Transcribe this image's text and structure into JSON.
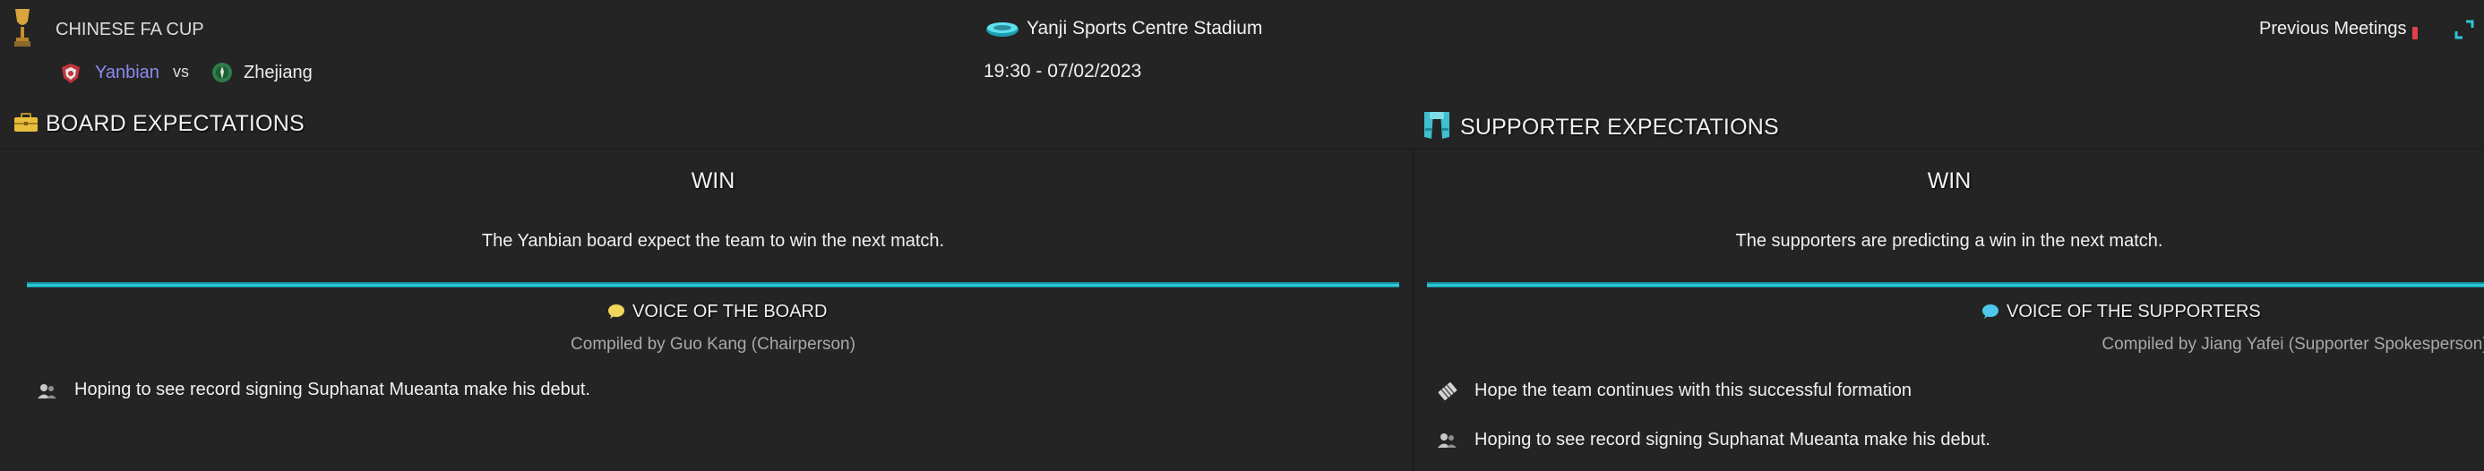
{
  "match": {
    "competition": "CHINESE FA CUP",
    "home_team": "Yanbian",
    "vs_label": "vs",
    "away_team": "Zhejiang",
    "venue": "Yanji Sports Centre Stadium",
    "kickoff": "19:30 - 07/02/2023",
    "previous_meetings_label": "Previous Meetings"
  },
  "board": {
    "title": "BOARD EXPECTATIONS",
    "expectation": "WIN",
    "description": "The Yanbian board expect the team to win the next match.",
    "voice_title": "VOICE OF THE BOARD",
    "compiled_by": "Compiled by Guo Kang (Chairperson)",
    "items": [
      {
        "text": "Hoping to see record signing Suphanat Mueanta make his debut.",
        "icon": "player-signing-icon"
      }
    ]
  },
  "supporters": {
    "title": "SUPPORTER EXPECTATIONS",
    "expectation": "WIN",
    "description": "The supporters are predicting a win in the next match.",
    "voice_title": "VOICE OF THE SUPPORTERS",
    "compiled_by": "Compiled by Jiang Yafei (Supporter Spokesperson)",
    "items": [
      {
        "text": "Hope the team continues with this successful formation",
        "icon": "tactics-board-icon"
      },
      {
        "text": "Hoping to see record signing Suphanat Mueanta make his debut.",
        "icon": "player-signing-icon"
      }
    ]
  },
  "colors": {
    "accent": "#2cc6d6",
    "home_team": "#8a8cf0",
    "background": "#242424",
    "board_bubble": "#f2d65a",
    "supporters_bubble": "#4cc8e8",
    "trophy": "#d9a53c"
  }
}
